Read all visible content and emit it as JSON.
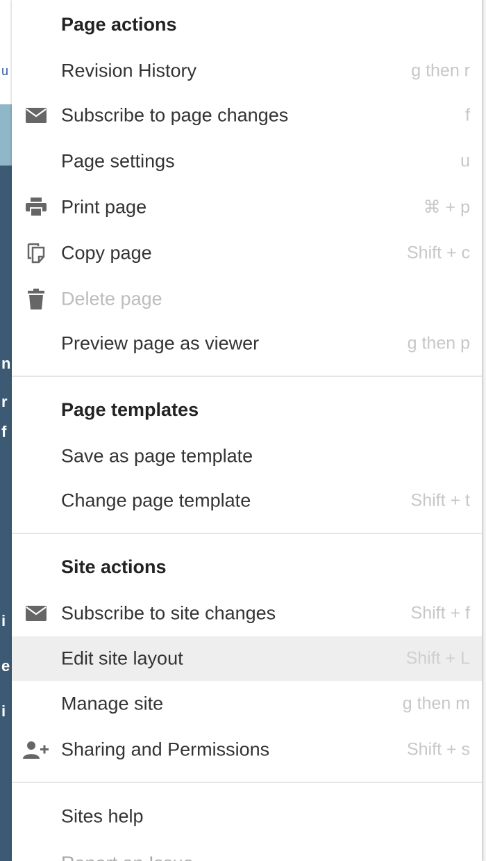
{
  "background_fragments": [
    "u",
    "n",
    "r",
    "f",
    "i",
    "e",
    "i"
  ],
  "menu": {
    "sections": [
      {
        "header": "Page actions",
        "items": [
          {
            "label": "Revision History",
            "shortcut": "g then r",
            "icon": ""
          },
          {
            "label": "Subscribe to page changes",
            "shortcut": "f",
            "icon": "envelope-icon"
          },
          {
            "label": "Page settings",
            "shortcut": "u",
            "icon": ""
          },
          {
            "label": "Print page",
            "shortcut": "⌘ + p",
            "icon": "printer-icon"
          },
          {
            "label": "Copy page",
            "shortcut": "Shift + c",
            "icon": "copy-icon"
          },
          {
            "label": "Delete page",
            "shortcut": "",
            "icon": "trash-icon",
            "disabled": true
          },
          {
            "label": "Preview page as viewer",
            "shortcut": "g then p",
            "icon": ""
          }
        ]
      },
      {
        "header": "Page templates",
        "items": [
          {
            "label": "Save as page template",
            "shortcut": "",
            "icon": ""
          },
          {
            "label": "Change page template",
            "shortcut": "Shift + t",
            "icon": ""
          }
        ]
      },
      {
        "header": "Site actions",
        "items": [
          {
            "label": "Subscribe to site changes",
            "shortcut": "Shift + f",
            "icon": "envelope-icon"
          },
          {
            "label": "Edit site layout",
            "shortcut": "Shift + L",
            "icon": "",
            "highlighted": true
          },
          {
            "label": "Manage site",
            "shortcut": "g then m",
            "icon": ""
          },
          {
            "label": "Sharing and Permissions",
            "shortcut": "Shift + s",
            "icon": "add-person-icon"
          }
        ]
      },
      {
        "header": "",
        "items": [
          {
            "label": "Sites help",
            "shortcut": "",
            "icon": ""
          },
          {
            "label": "Report an Issue",
            "shortcut": "",
            "icon": ""
          }
        ]
      }
    ]
  },
  "colors": {
    "text": "#333333",
    "header_text": "#222222",
    "shortcut_text": "#c7c7c7",
    "disabled_text": "#bdbdbd",
    "highlight_bg": "#eeeeee",
    "icon": "#666666"
  }
}
